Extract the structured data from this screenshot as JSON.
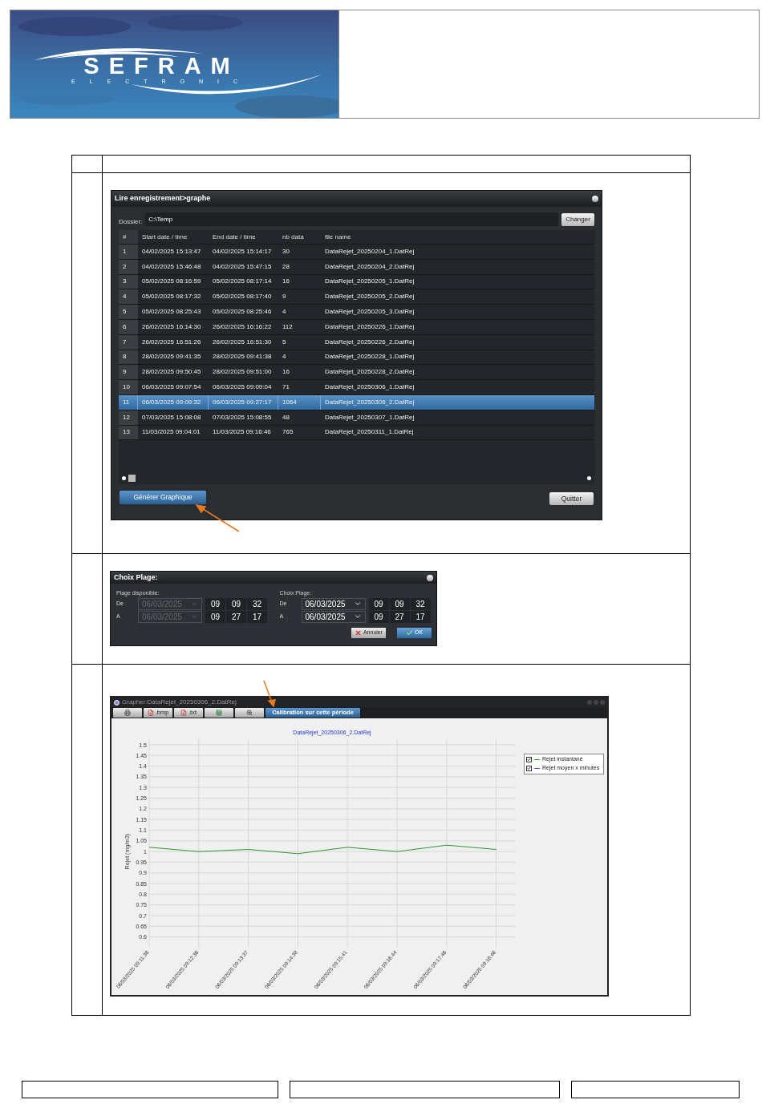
{
  "header": {
    "logo": {
      "name": "SEFRAM",
      "tagline": "ELECTRONIC"
    }
  },
  "records_window": {
    "title": "Lire enregistrement>graphe",
    "folder_label": "Dossier:",
    "folder_value": "C:\\Temp",
    "change_button": "Changer",
    "columns": [
      "#",
      "Start date / time",
      "End date / time",
      "nb data",
      "file name"
    ],
    "rows": [
      {
        "cells": [
          "1",
          "04/02/2025 15:13:47",
          "04/02/2025 15:14:17",
          "30",
          "DataRejet_20250204_1.DatRej"
        ],
        "selected": false
      },
      {
        "cells": [
          "2",
          "04/02/2025 15:46:48",
          "04/02/2025 15:47:15",
          "28",
          "DataRejet_20250204_2.DatRej"
        ],
        "selected": false
      },
      {
        "cells": [
          "3",
          "05/02/2025 08:16:59",
          "05/02/2025 08:17:14",
          "16",
          "DataRejet_20250205_1.DatRej"
        ],
        "selected": false
      },
      {
        "cells": [
          "4",
          "05/02/2025 08:17:32",
          "05/02/2025 08:17:40",
          "9",
          "DataRejet_20250205_2.DatRej"
        ],
        "selected": false
      },
      {
        "cells": [
          "5",
          "05/02/2025 08:25:43",
          "05/02/2025 08:25:46",
          "4",
          "DataRejet_20250205_3.DatRej"
        ],
        "selected": false
      },
      {
        "cells": [
          "6",
          "26/02/2025 16:14:30",
          "26/02/2025 16:16:22",
          "112",
          "DataRejet_20250226_1.DatRej"
        ],
        "selected": false
      },
      {
        "cells": [
          "7",
          "26/02/2025 16:51:26",
          "26/02/2025 16:51:30",
          "5",
          "DataRejet_20250226_2.DatRej"
        ],
        "selected": false
      },
      {
        "cells": [
          "8",
          "28/02/2025 09:41:35",
          "28/02/2025 09:41:38",
          "4",
          "DataRejet_20250228_1.DatRej"
        ],
        "selected": false
      },
      {
        "cells": [
          "9",
          "28/02/2025 09:50:45",
          "28/02/2025 09:51:00",
          "16",
          "DataRejet_20250228_2.DatRej"
        ],
        "selected": false
      },
      {
        "cells": [
          "10",
          "06/03/2025 09:07:54",
          "06/03/2025 09:09:04",
          "71",
          "DataRejet_20250306_1.DatRej"
        ],
        "selected": false
      },
      {
        "cells": [
          "11",
          "06/03/2025 09:09:32",
          "06/03/2025 09:27:17",
          "1064",
          "DataRejet_20250306_2.DatRej"
        ],
        "selected": true
      },
      {
        "cells": [
          "12",
          "07/03/2025 15:08:08",
          "07/03/2025 15:08:55",
          "48",
          "DataRejet_20250307_1.DatRej"
        ],
        "selected": false
      },
      {
        "cells": [
          "13",
          "11/03/2025 09:04:01",
          "11/03/2025 09:16:46",
          "765",
          "DataRejet_20250311_1.DatRej"
        ],
        "selected": false
      }
    ],
    "generate_button": "Générer Graphique",
    "quit_button": "Quitter"
  },
  "range_dialog": {
    "title": "Choix Plage:",
    "groups": [
      {
        "label": "Plage disponible:",
        "disabled": true,
        "rows": [
          {
            "label": "De",
            "date": "06/03/2025",
            "time": [
              "09",
              "09",
              "32"
            ]
          },
          {
            "label": "A",
            "date": "06/03/2025",
            "time": [
              "09",
              "27",
              "17"
            ]
          }
        ]
      },
      {
        "label": "Choix Plage:",
        "disabled": false,
        "rows": [
          {
            "label": "De",
            "date": "06/03/2025",
            "time": [
              "09",
              "09",
              "32"
            ]
          },
          {
            "label": "A",
            "date": "06/03/2025",
            "time": [
              "09",
              "27",
              "17"
            ]
          }
        ]
      }
    ],
    "buttons": [
      {
        "kind": "cancel",
        "label": "Annuler"
      },
      {
        "kind": "ok",
        "label": "OK"
      }
    ]
  },
  "grapher_window": {
    "title": "Grapher:DataRejet_20250306_2.DatRej",
    "toolbar": [
      {
        "kind": "print"
      },
      {
        "kind": "export",
        "label": ".bmp"
      },
      {
        "kind": "export",
        "label": ".txt"
      },
      {
        "kind": "spreadsheet"
      },
      {
        "kind": "zoom"
      },
      {
        "kind": "action",
        "label": "Calibration sur cette période"
      }
    ],
    "legend": [
      {
        "checked": true
      },
      {
        "checked": true
      }
    ],
    "chart_data": {
      "type": "line",
      "title": "DataRejet_20250306_2.DatRej",
      "ylabel": "Rejet (mg/m3)",
      "ylim": [
        0.55,
        1.5
      ],
      "yticks": [
        0.6,
        0.65,
        0.7,
        0.75,
        0.8,
        0.85,
        0.9,
        0.95,
        1,
        1.05,
        1.1,
        1.15,
        1.2,
        1.25,
        1.3,
        1.35,
        1.4,
        1.45,
        1.5
      ],
      "grid": true,
      "categories": [
        "06/03/2025 09:11:36",
        "06/03/2025 09:12:36",
        "06/03/2025 09:13:37",
        "06/03/2025 09:14:38",
        "06/03/2025 09:15:41",
        "06/03/2025 09:16:44",
        "06/03/2025 09:17:46",
        "06/03/2025 09:18:46"
      ],
      "series": [
        {
          "name": "Rejet instantané",
          "color": "#2e9b2e",
          "values": [
            1.02,
            1.0,
            1.01,
            0.99,
            1.02,
            1.0,
            1.03,
            1.01
          ]
        },
        {
          "name": "Rejet moyen x minutes",
          "color": "#3355cc",
          "values": [
            null,
            null,
            null,
            null,
            null,
            null,
            null,
            null
          ]
        }
      ]
    }
  }
}
